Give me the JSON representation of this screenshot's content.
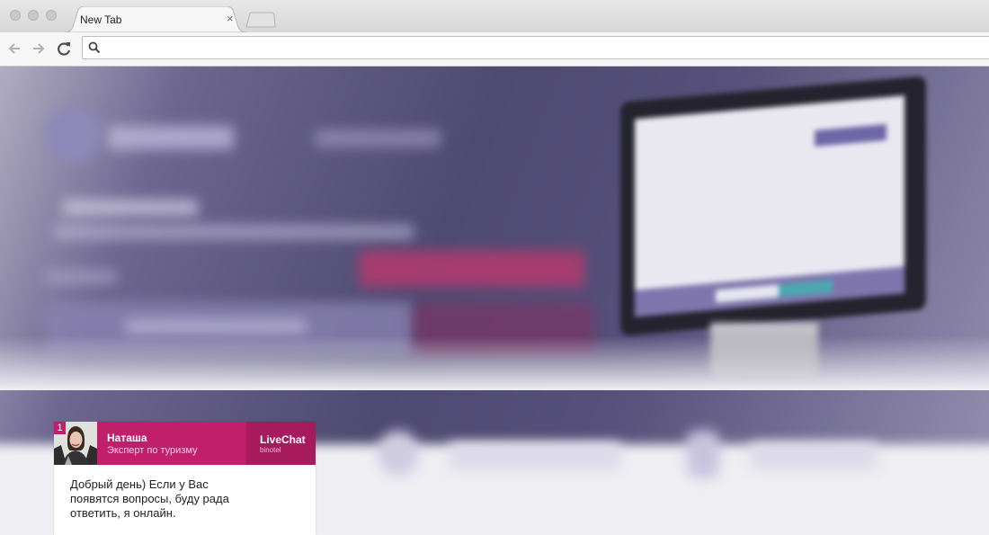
{
  "browser": {
    "tab_title": "New Tab",
    "tab_close": "×",
    "address_value": ""
  },
  "chat": {
    "badge": "1",
    "agent_name": "Наташа",
    "agent_role": "Эксперт по туризму",
    "brand": "LiveChat",
    "brand_sub": "binotel",
    "message": "Добрый день) Если у Вас появятся вопросы, буду рада ответить, я онлайн.",
    "accent_color": "#c11f6c"
  }
}
